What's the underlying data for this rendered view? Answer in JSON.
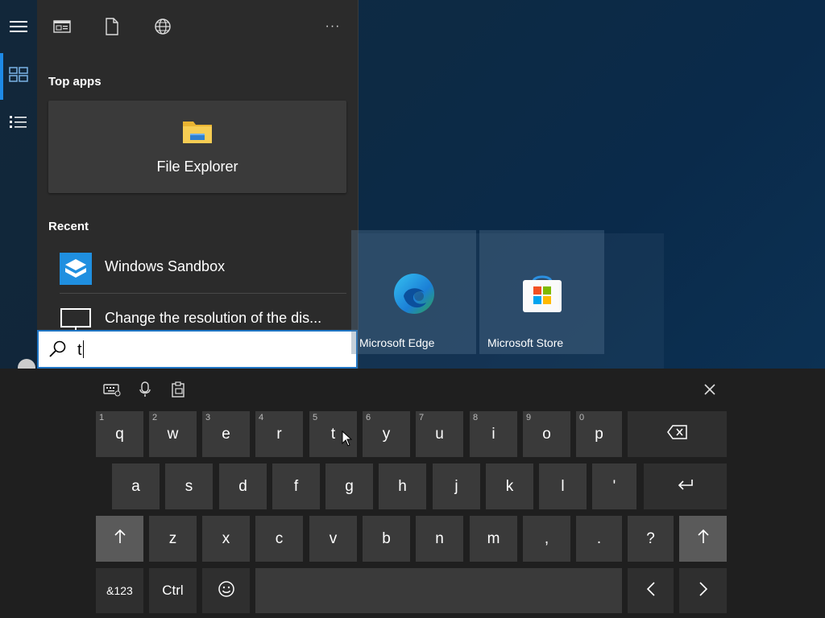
{
  "start_menu": {
    "toolbar_icons": [
      "apps-filter-icon",
      "documents-filter-icon",
      "web-filter-icon",
      "more-options-icon"
    ],
    "more_label": "···",
    "top_apps_title": "Top apps",
    "top_app": {
      "label": "File Explorer",
      "icon": "folder-icon"
    },
    "recent_title": "Recent",
    "recent": [
      {
        "label": "Windows Sandbox",
        "icon": "sandbox-icon"
      },
      {
        "label": "Change the resolution of the dis...",
        "icon": "monitor-icon"
      }
    ]
  },
  "search": {
    "value": "t"
  },
  "tiles": [
    {
      "label": "Microsoft Edge",
      "icon": "edge-icon"
    },
    {
      "label": "Microsoft Store",
      "icon": "store-icon"
    }
  ],
  "keyboard": {
    "row1": [
      {
        "num": "1",
        "key": "q"
      },
      {
        "num": "2",
        "key": "w"
      },
      {
        "num": "3",
        "key": "e"
      },
      {
        "num": "4",
        "key": "r"
      },
      {
        "num": "5",
        "key": "t"
      },
      {
        "num": "6",
        "key": "y"
      },
      {
        "num": "7",
        "key": "u"
      },
      {
        "num": "8",
        "key": "i"
      },
      {
        "num": "9",
        "key": "o"
      },
      {
        "num": "0",
        "key": "p"
      }
    ],
    "row2": [
      "a",
      "s",
      "d",
      "f",
      "g",
      "h",
      "j",
      "k",
      "l",
      "'"
    ],
    "row3": [
      "z",
      "x",
      "c",
      "v",
      "b",
      "n",
      "m",
      ",",
      ".",
      "?"
    ],
    "sym_label": "&123",
    "ctrl_label": "Ctrl"
  },
  "colors": {
    "accent": "#1e8ae6",
    "flyout": "#2b2b2b",
    "key": "#3a3a3a",
    "keyboard_bg": "#1f1f1f"
  }
}
